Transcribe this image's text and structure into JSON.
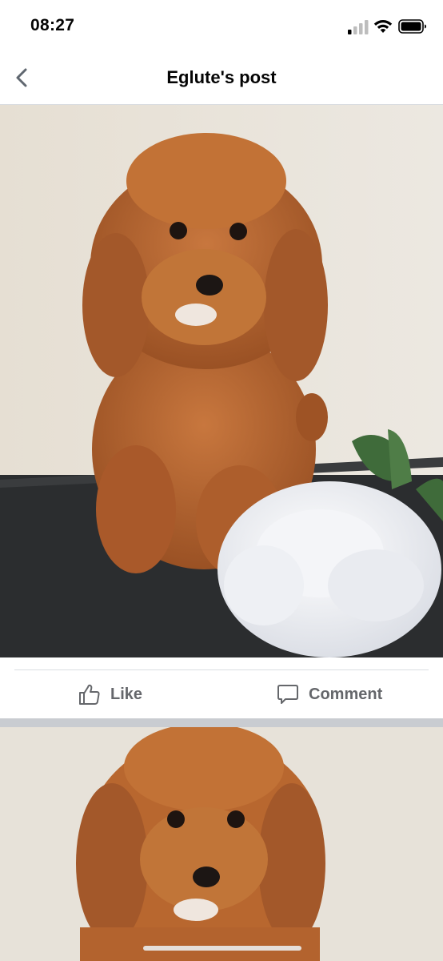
{
  "status_bar": {
    "time": "08:27",
    "icons": [
      "cellular-signal-icon",
      "wifi-icon",
      "battery-icon"
    ]
  },
  "header": {
    "title": "Eglute's post",
    "back_icon": "chevron-left-icon"
  },
  "post": {
    "photos": [
      {
        "description_icon": "photo"
      },
      {
        "description_icon": "photo"
      }
    ],
    "actions": {
      "like_label": "Like",
      "comment_label": "Comment"
    }
  },
  "colors": {
    "action_text": "#65676b",
    "divider": "#dadde1",
    "separator": "#c9ccd1"
  }
}
